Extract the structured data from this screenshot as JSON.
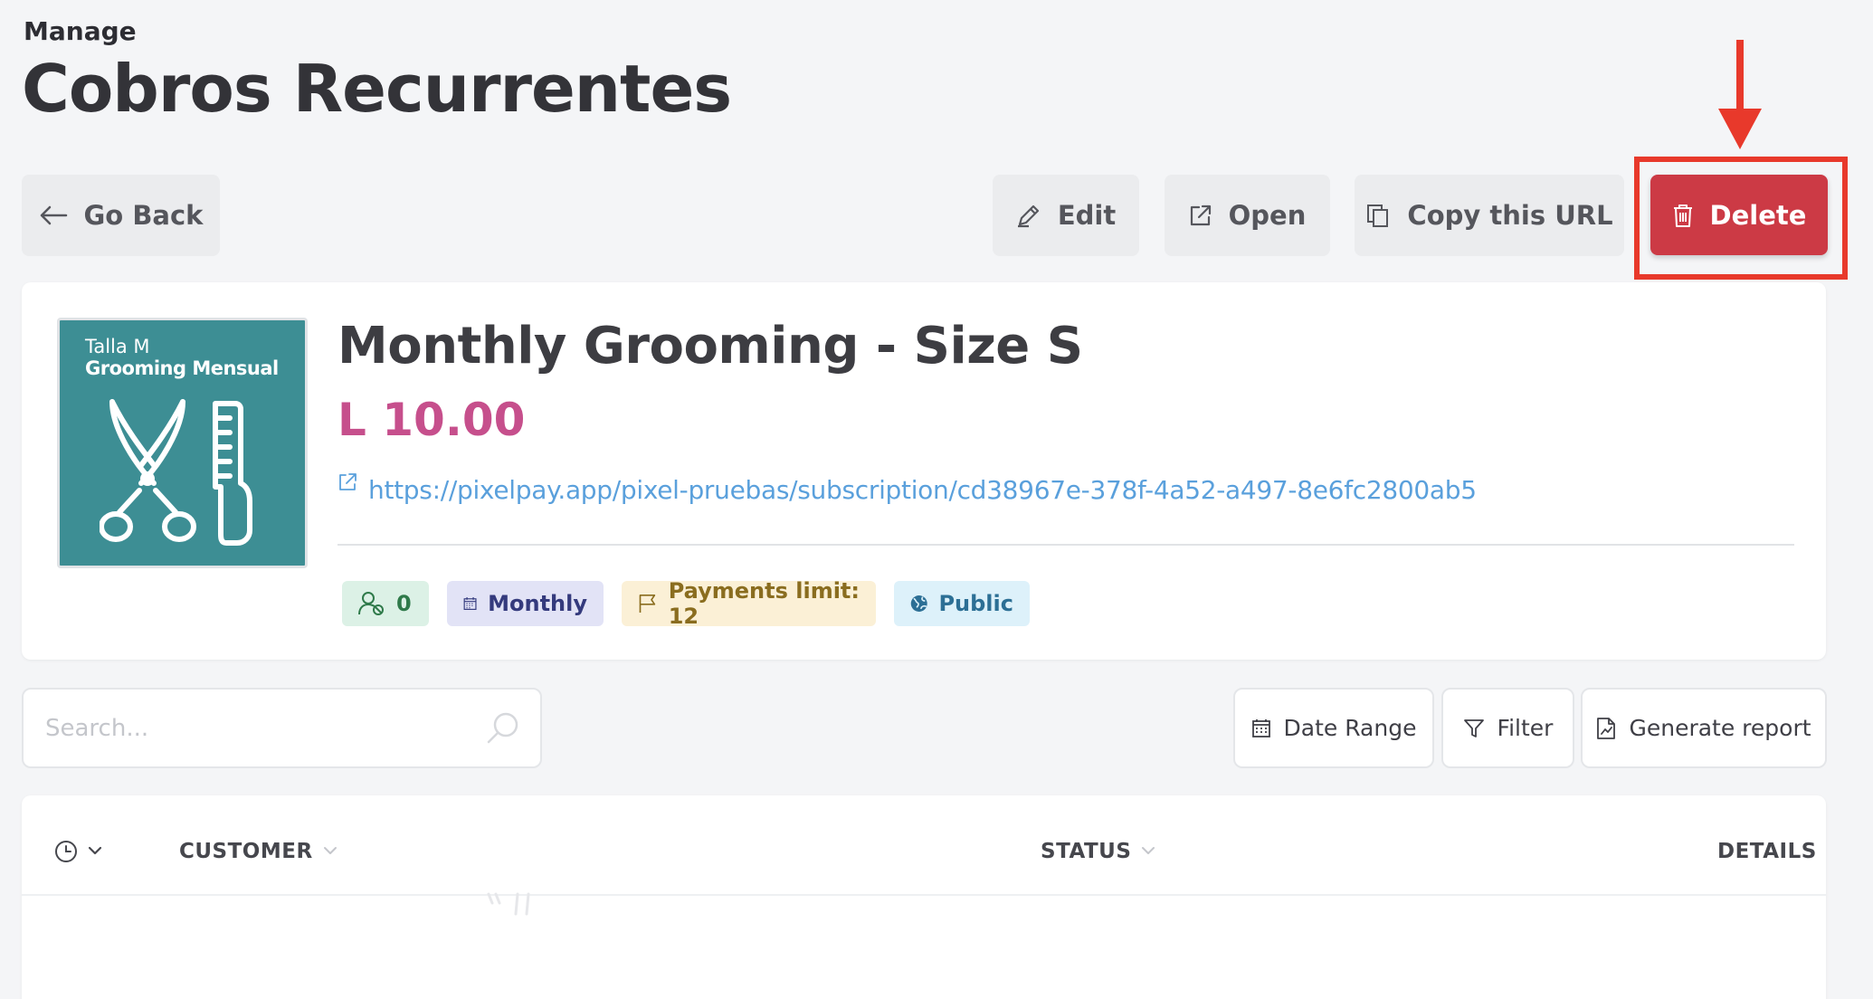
{
  "header": {
    "manage_label": "Manage",
    "title": "Cobros Recurrentes"
  },
  "toolbar": {
    "back_label": "Go Back",
    "edit_label": "Edit",
    "open_label": "Open",
    "copy_label": "Copy this URL",
    "delete_label": "Delete"
  },
  "product": {
    "thumbnail_line1": "Talla M",
    "thumbnail_line2": "Grooming Mensual",
    "title": "Monthly Grooming - Size S",
    "price": "L 10.00",
    "url": "https://pixelpay.app/pixel-pruebas/subscription/cd38967e-378f-4a52-a497-8e6fc2800ab5",
    "badges": {
      "users": "0",
      "frequency": "Monthly",
      "payments_limit": "Payments limit: 12",
      "visibility": "Public"
    }
  },
  "filters": {
    "search_placeholder": "Search...",
    "date_range_label": "Date Range",
    "filter_label": "Filter",
    "report_label": "Generate report"
  },
  "table": {
    "columns": [
      "CUSTOMER",
      "STATUS",
      "DETAILS"
    ]
  },
  "colors": {
    "delete": "#cc3a45",
    "highlight": "#e8392b",
    "price": "#c64f8c",
    "link": "#5aa0dc",
    "thumbnail": "#3d8e94"
  },
  "icons": {
    "back": "arrow-left-icon",
    "edit": "pencil-icon",
    "open": "external-link-icon",
    "copy": "copy-icon",
    "delete": "trash-icon",
    "users": "users-icon",
    "frequency": "calendar-icon",
    "limit": "flag-icon",
    "visibility": "globe-icon",
    "search": "search-icon",
    "date_range": "calendar-icon",
    "filter": "funnel-icon",
    "report": "document-chart-icon",
    "time": "clock-icon"
  }
}
